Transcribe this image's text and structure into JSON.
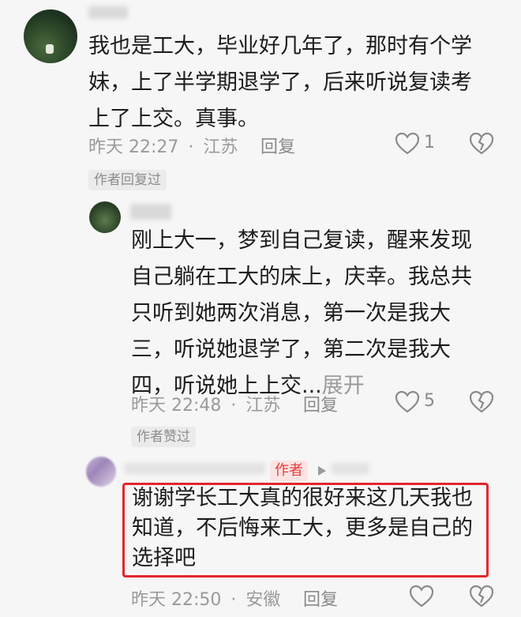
{
  "comments": [
    {
      "text_lines": [
        "我也是工大，毕业好几年了，那时有个学",
        "妹，上了半学期退学了，后来听说复读考",
        "上了上交。真事。"
      ],
      "time": "昨天 22:27",
      "location": "江苏",
      "reply_label": "回复",
      "like_count": "1",
      "tag": "作者回复过"
    },
    {
      "text_lines": [
        "刚上大一，梦到自己复读，醒来发现",
        "自己躺在工大的床上，庆幸。我总共",
        "只听到她两次消息，第一次是我大",
        "三，听说她退学了，第二次是我大",
        "四，听说她上上交..."
      ],
      "expand_label": "展开",
      "time": "昨天 22:48",
      "location": "江苏",
      "reply_label": "回复",
      "like_count": "5",
      "tag": "作者赞过"
    },
    {
      "author_badge": "作者",
      "text_lines": [
        "谢谢学长工大真的很好来这几天我也",
        "知道，不后悔来工大，更多是自己的",
        "选择吧"
      ],
      "time": "昨天 22:50",
      "location": "安徽",
      "reply_label": "回复"
    }
  ],
  "separator": "·",
  "colors": {
    "highlight": "#e4262b",
    "author_badge_text": "#e63c3c"
  }
}
